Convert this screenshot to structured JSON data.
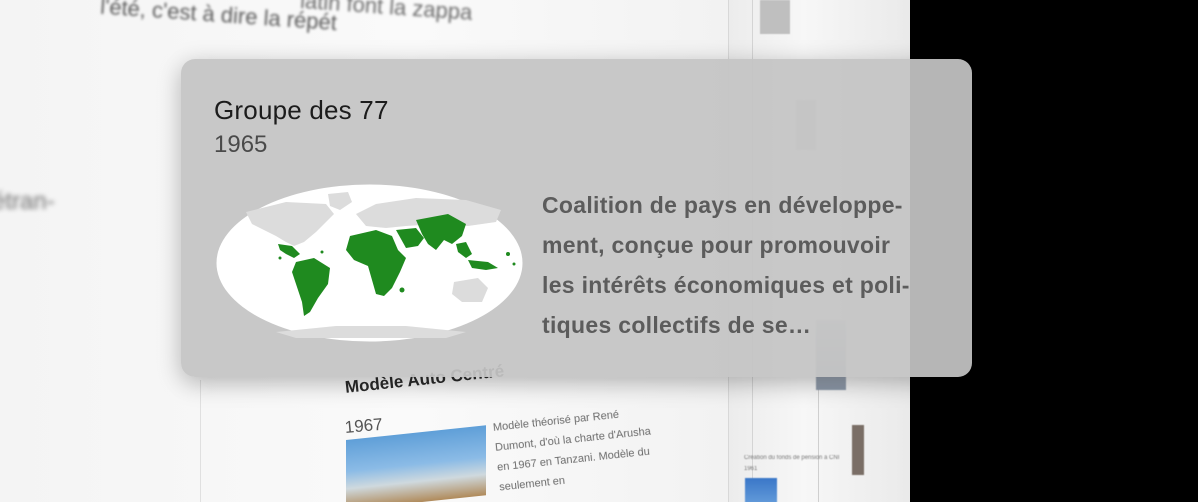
{
  "popover": {
    "title": "Groupe des 77",
    "year": "1965",
    "description_lines": [
      "Coalition de pays en développe-",
      "ment, conçue pour promouvoir",
      "les intérêts économiques et poli-",
      "tiques collectifs de se…"
    ],
    "map_image": "world-map-g77-members-green",
    "colors": {
      "member_countries": "#1f8a1f",
      "other_countries": "#dcdcdc",
      "ocean": "#ffffff"
    }
  },
  "background": {
    "text_top_right": "latin font la zappa",
    "text_top_left": "l'été, c'est à dire la répét",
    "text_left_fragment": "étran-",
    "entry": {
      "title": "Modèle Auto Centré",
      "year": "1967",
      "text": "Modèle théorisé par René Dumont, d'où la charte d'Arusha en 1967 en Tanzani. Modèle du seulement en"
    },
    "side_entry_title": "Création du fonds de pension à CNI",
    "side_entry_year": "1961"
  }
}
